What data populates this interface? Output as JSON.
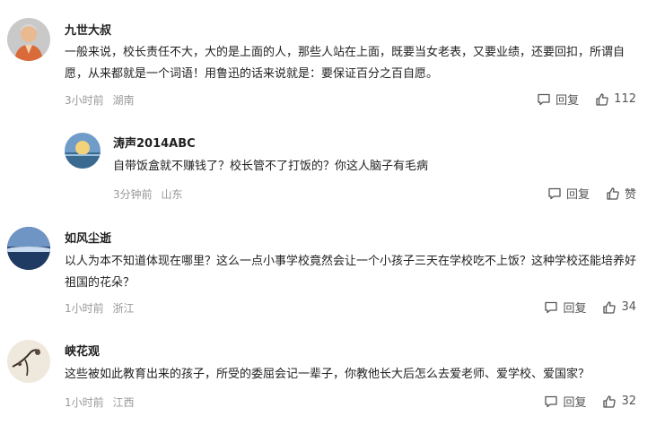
{
  "comments": [
    {
      "user": "九世大叔",
      "text": "一般来说，校长责任不大，大的是上面的人，那些人站在上面，既要当女老表，又要业绩，还要回扣，所谓自愿，从来都就是一个词语！用鲁迅的话来说就是：要保证百分之百自愿。",
      "time": "3小时前",
      "location": "湖南",
      "reply_label": "回复",
      "likes": "112"
    },
    {
      "user": "涛声2014ABC",
      "text": "自带饭盒就不赚钱了？校长管不了打饭的？你这人脑子有毛病",
      "time": "3分钟前",
      "location": "山东",
      "reply_label": "回复",
      "likes": "赞"
    },
    {
      "user": "如风尘逝",
      "text": "以人为本不知道体现在哪里？这么一点小事学校竟然会让一个小孩子三天在学校吃不上饭？这种学校还能培养好祖国的花朵？",
      "time": "1小时前",
      "location": "浙江",
      "reply_label": "回复",
      "likes": "34"
    },
    {
      "user": "峡花观",
      "text": "这些被如此教育出来的孩子，所受的委屈会记一辈子，你教他长大后怎么去爱老师、爱学校、爱国家？",
      "time": "1小时前",
      "location": "江西",
      "reply_label": "回复",
      "likes": "32"
    }
  ]
}
